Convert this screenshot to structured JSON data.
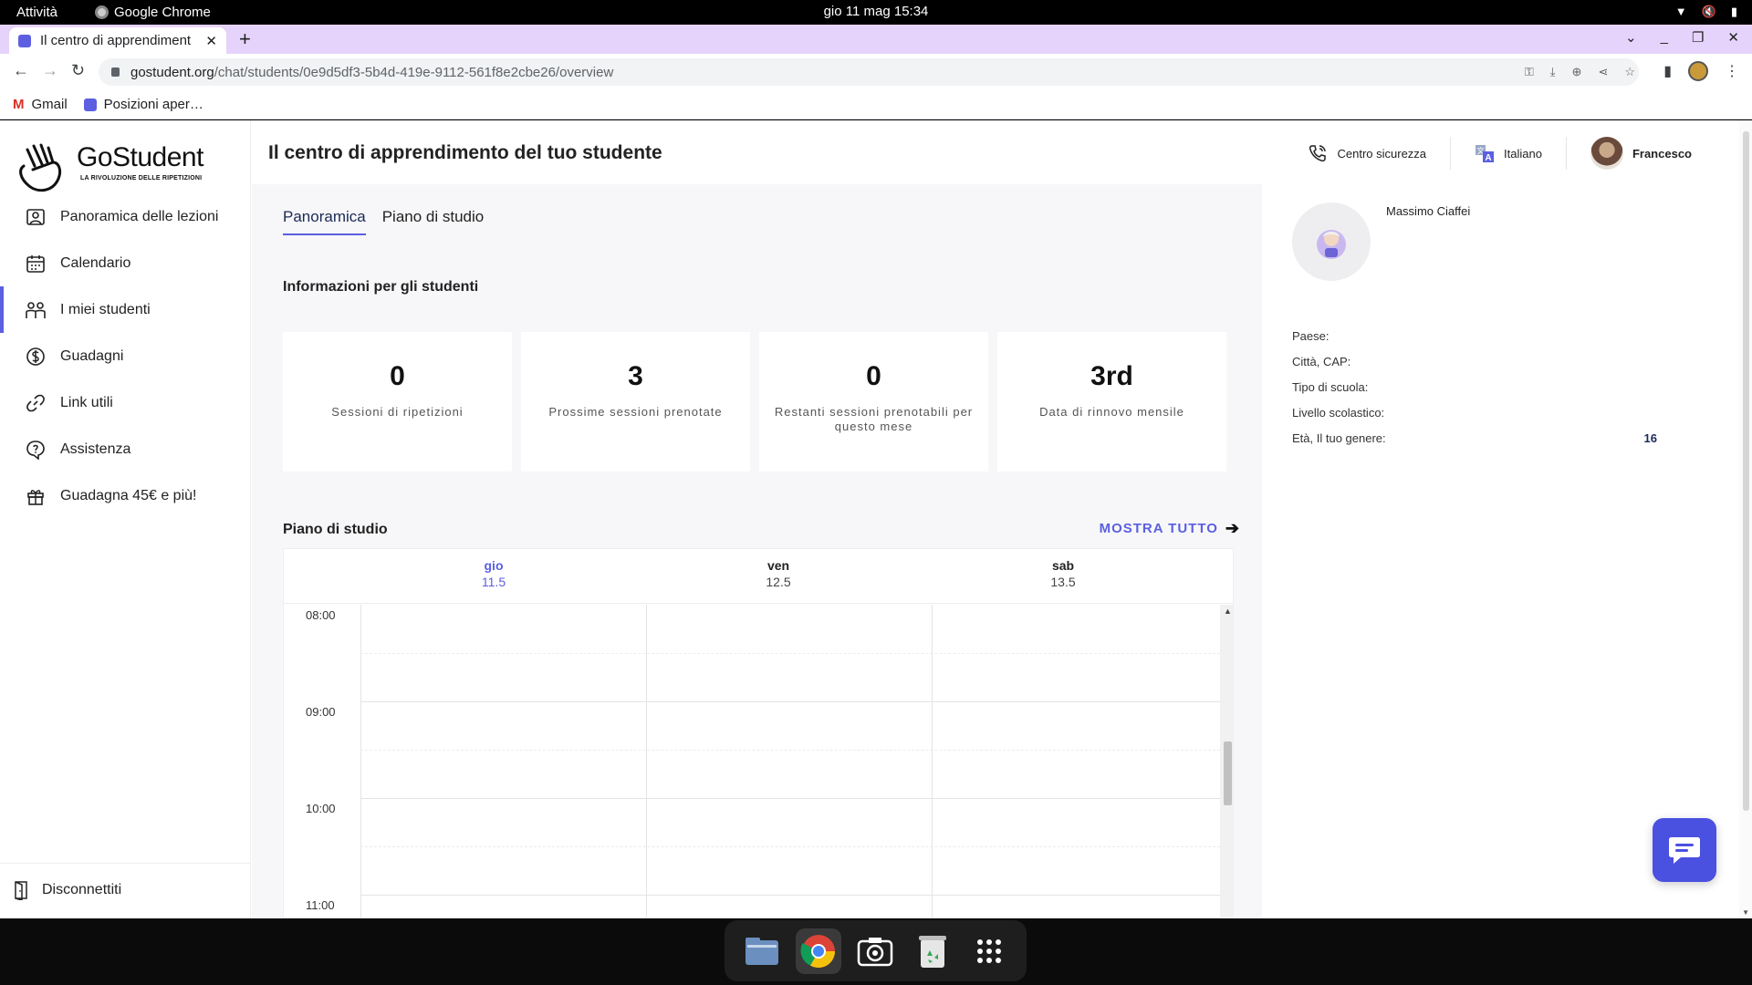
{
  "system_bar": {
    "activities": "Attività",
    "app_name": "Google Chrome",
    "clock": "gio 11 mag  15:34"
  },
  "browser": {
    "tab_title": "Il centro di apprendiment",
    "url_host": "gostudent.org",
    "url_path": "/chat/students/0e9d5df3-5b4d-419e-9112-561f8e2cbe26/overview",
    "bookmarks": [
      {
        "label": "Gmail"
      },
      {
        "label": "Posizioni aper…"
      }
    ]
  },
  "brand": {
    "name": "GoStudent",
    "tagline": "LA RIVOLUZIONE DELLE RIPETIZIONI"
  },
  "sidebar": {
    "items": [
      {
        "label": "Panoramica delle lezioni",
        "icon": "lessons-overview-icon"
      },
      {
        "label": "Calendario",
        "icon": "calendar-icon"
      },
      {
        "label": "I miei studenti",
        "icon": "students-icon",
        "active": true
      },
      {
        "label": "Guadagni",
        "icon": "earnings-icon"
      },
      {
        "label": "Link utili",
        "icon": "link-icon"
      },
      {
        "label": "Assistenza",
        "icon": "support-icon"
      },
      {
        "label": "Guadagna 45€ e più!",
        "icon": "gift-icon"
      }
    ],
    "logout": "Disconnettiti"
  },
  "header": {
    "title": "Il centro di apprendimento del tuo studente",
    "safety": "Centro sicurezza",
    "language": "Italiano",
    "user": "Francesco"
  },
  "main": {
    "tabs": [
      {
        "label": "Panoramica",
        "active": true
      },
      {
        "label": "Piano di studio",
        "active": false
      }
    ],
    "info_title": "Informazioni per gli studenti",
    "stats": [
      {
        "value": "0",
        "label": "Sessioni di ripetizioni"
      },
      {
        "value": "3",
        "label": "Prossime sessioni prenotate"
      },
      {
        "value": "0",
        "label": "Restanti sessioni prenotabili per questo mese"
      },
      {
        "value": "3rd",
        "label": "Data di rinnovo mensile"
      }
    ],
    "study_plan_title": "Piano di studio",
    "show_all": "MOSTRA TUTTO",
    "calendar": {
      "days": [
        {
          "name": "gio",
          "date": "11.5",
          "today": true
        },
        {
          "name": "ven",
          "date": "12.5",
          "today": false
        },
        {
          "name": "sab",
          "date": "13.5",
          "today": false
        }
      ],
      "hours": [
        "08:00",
        "09:00",
        "10:00",
        "11:00"
      ]
    }
  },
  "student": {
    "name": "Massimo Ciaffei",
    "fields": [
      {
        "label": "Paese:",
        "value": ""
      },
      {
        "label": "Città, CAP:",
        "value": ""
      },
      {
        "label": "Tipo di scuola:",
        "value": ""
      },
      {
        "label": "Livello scolastico:",
        "value": ""
      },
      {
        "label": "Età, Il tuo genere:",
        "value": "16"
      }
    ]
  },
  "colors": {
    "accent": "#5b5fe0",
    "tabstrip": "#e6d3fb",
    "chat_button": "#4a50e0"
  }
}
